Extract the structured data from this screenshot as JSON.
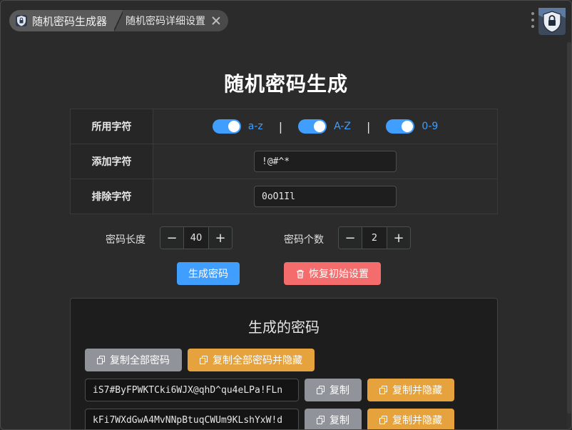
{
  "breadcrumb": {
    "home_label": "随机密码生成器",
    "current_label": "随机密码详细设置"
  },
  "page": {
    "title": "随机密码生成"
  },
  "settings": {
    "charset_label": "所用字符",
    "charsets": [
      {
        "label": "a-z",
        "enabled": true
      },
      {
        "label": "A-Z",
        "enabled": true
      },
      {
        "label": "0-9",
        "enabled": true
      }
    ],
    "separator": "|",
    "add_label": "添加字符",
    "add_value": "!@#^*",
    "exclude_label": "排除字符",
    "exclude_value": "0oO1Il"
  },
  "length": {
    "label": "密码长度",
    "value": "40",
    "minus": "−",
    "plus": "+"
  },
  "count": {
    "label": "密码个数",
    "value": "2",
    "minus": "−",
    "plus": "+"
  },
  "actions": {
    "generate_label": "生成密码",
    "reset_label": "恢复初始设置"
  },
  "result": {
    "title": "生成的密码",
    "copy_all_label": "复制全部密码",
    "copy_all_hide_label": "复制全部密码并隐藏",
    "passwords": [
      {
        "value": "iS7#ByFPWKTCki6WJX@qhD^qu4eLPa!FLn",
        "copy_label": "复制",
        "copy_hide_label": "复制并隐藏"
      },
      {
        "value": "kFi7WXdGwA4MvNNpBtuqCWUm9KLshYxW!d",
        "copy_label": "复制",
        "copy_hide_label": "复制并隐藏"
      }
    ]
  },
  "colors": {
    "primary": "#409eff",
    "danger": "#f56c6c",
    "warning": "#e6a23c",
    "info": "#909399",
    "background": "#2b2b2c"
  },
  "icons": [
    "app-lock-icon",
    "close-icon",
    "more-vertical-icon",
    "avatar-lock-icon",
    "trash-icon",
    "copy-icon"
  ]
}
